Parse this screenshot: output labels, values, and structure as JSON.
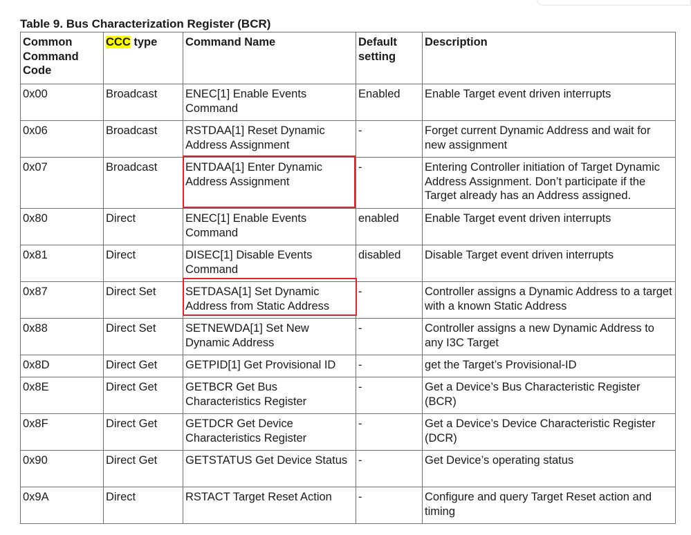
{
  "caption": "Table 9.  Bus Characterization Register (BCR)",
  "headers": {
    "code": "Common Command Code",
    "type_highlight": "CCC",
    "type_rest": " type",
    "name": "Command Name",
    "default": "Default setting",
    "description": "Description"
  },
  "highlight_color": "#ffff00",
  "annotation_color": "#e0242a",
  "rows": [
    {
      "code": "0x00",
      "type": "Broadcast",
      "name": "ENEC[1] Enable Events Command",
      "default": "Enabled",
      "description": "Enable Target event driven interrupts"
    },
    {
      "code": "0x06",
      "type": "Broadcast",
      "name": "RSTDAA[1] Reset Dynamic Address Assignment",
      "default": "-",
      "description": "Forget current Dynamic Address and wait for new assignment"
    },
    {
      "code": "0x07",
      "type": "Broadcast",
      "name": "ENTDAA[1] Enter Dynamic Address Assignment",
      "default": "-",
      "description": "Entering Controller initiation of Target Dynamic Address Assignment. Don’t participate if the Target already has an Address assigned."
    },
    {
      "code": "0x80",
      "type": "Direct",
      "name": "ENEC[1] Enable Events Command",
      "default": "enabled",
      "description": "Enable Target event driven interrupts"
    },
    {
      "code": "0x81",
      "type": "Direct",
      "name": "DISEC[1] Disable Events Command",
      "default": "disabled",
      "description": "Disable Target event driven interrupts"
    },
    {
      "code": "0x87",
      "type": "Direct Set",
      "name": "SETDASA[1] Set Dynamic Address from Static Address",
      "default": "-",
      "description": "Controller assigns a Dynamic Address to a target with a known Static Address"
    },
    {
      "code": "0x88",
      "type": "Direct Set",
      "name": "SETNEWDA[1] Set New Dynamic Address",
      "default": "-",
      "description": "Controller assigns a new Dynamic Address to any I3C Target"
    },
    {
      "code": "0x8D",
      "type": "Direct Get",
      "name": "GETPID[1] Get Provisional ID",
      "default": "-",
      "description": "get the Target’s Provisional-ID"
    },
    {
      "code": "0x8E",
      "type": "Direct Get",
      "name": "GETBCR Get Bus Characteristics Register",
      "default": "-",
      "description": "Get a Device’s Bus Characteristic Register (BCR)"
    },
    {
      "code": "0x8F",
      "type": "Direct Get",
      "name": "GETDCR Get Device Characteristics Register",
      "default": "-",
      "description": "Get a Device’s Device Characteristic Register (DCR)"
    },
    {
      "code": "0x90",
      "type": "Direct Get",
      "name": "GETSTATUS Get Device Status",
      "default": "-",
      "description": "Get Device’s operating status"
    },
    {
      "code": "0x9A",
      "type": "Direct",
      "name": "RSTACT Target Reset Action",
      "default": "-",
      "description": "Configure and query Target Reset action and timing"
    }
  ]
}
